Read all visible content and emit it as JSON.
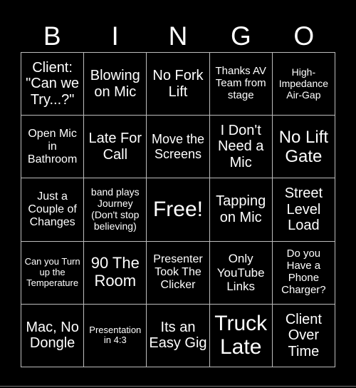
{
  "header": {
    "letters": [
      "B",
      "I",
      "N",
      "G",
      "O"
    ]
  },
  "grid": {
    "rows": [
      [
        "Client: \"Can we Try...?\"",
        "Blowing on Mic",
        "No Fork Lift",
        "Thanks AV Team from stage",
        "High-Impedance Air-Gap"
      ],
      [
        "Open Mic in Bathroom",
        "Late For Call",
        "Move the Screens",
        "I Don't Need a Mic",
        "No Lift Gate"
      ],
      [
        "Just a Couple of Changes",
        "band plays Journey (Don't stop believing)",
        "Free!",
        "Tapping on Mic",
        "Street Level Load"
      ],
      [
        "Can you Turn up the Temperature",
        "90 The Room",
        "Presenter Took The Clicker",
        "Only YouTube Links",
        "Do you Have a Phone Charger?"
      ],
      [
        "Mac, No Dongle",
        "Presentation in 4:3",
        "Its an Easy Gig",
        "Truck Late",
        "Client Over Time"
      ]
    ]
  },
  "colors": {
    "background": "#000000",
    "text": "#ffffff",
    "grid_line": "#bdbdbd"
  }
}
